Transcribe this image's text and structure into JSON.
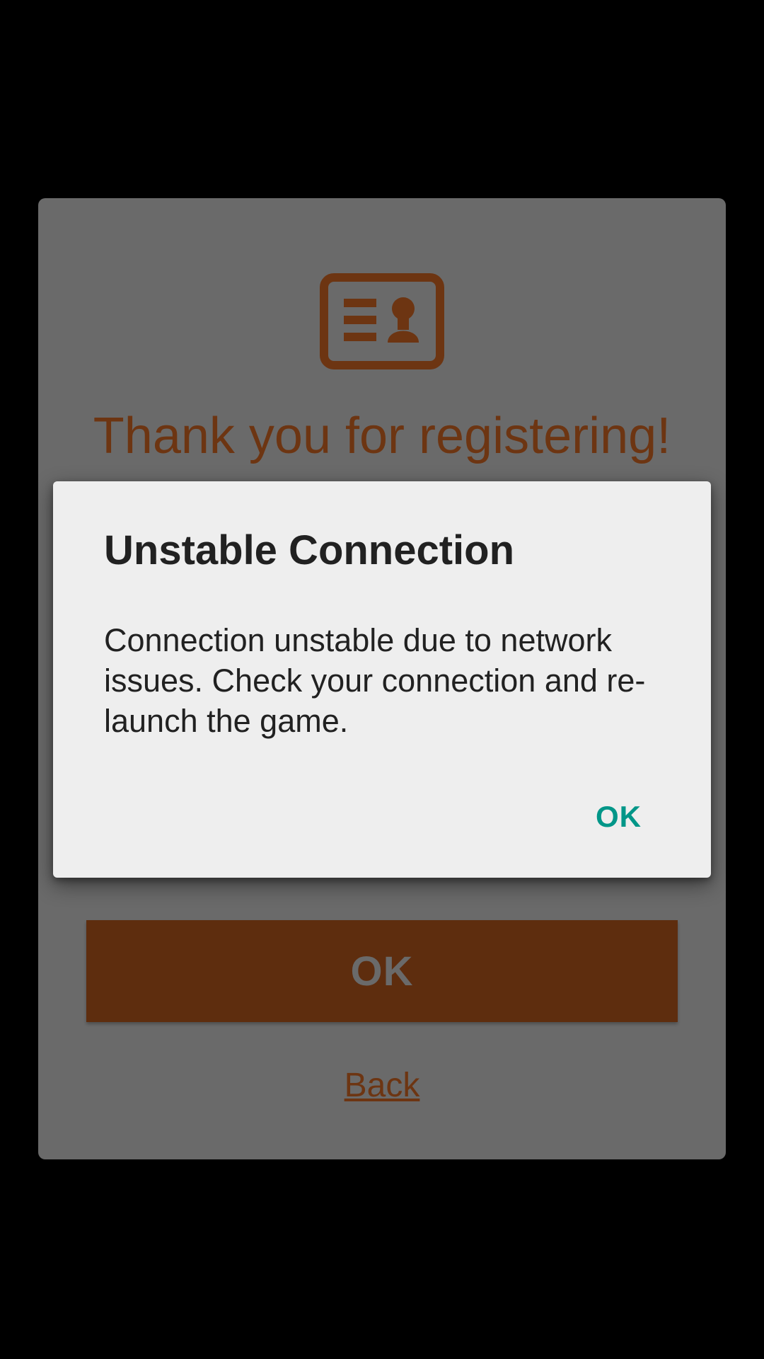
{
  "registration_card": {
    "icon": "id-card-icon",
    "title": "Thank you for registering!",
    "ok_label": "OK",
    "back_label": "Back",
    "accent_color": "#6d3512"
  },
  "dialog": {
    "title": "Unstable Connection",
    "message": "Connection unstable due to network issues. Check your connection and re-launch the game.",
    "ok_label": "OK",
    "ok_color": "#009688"
  }
}
